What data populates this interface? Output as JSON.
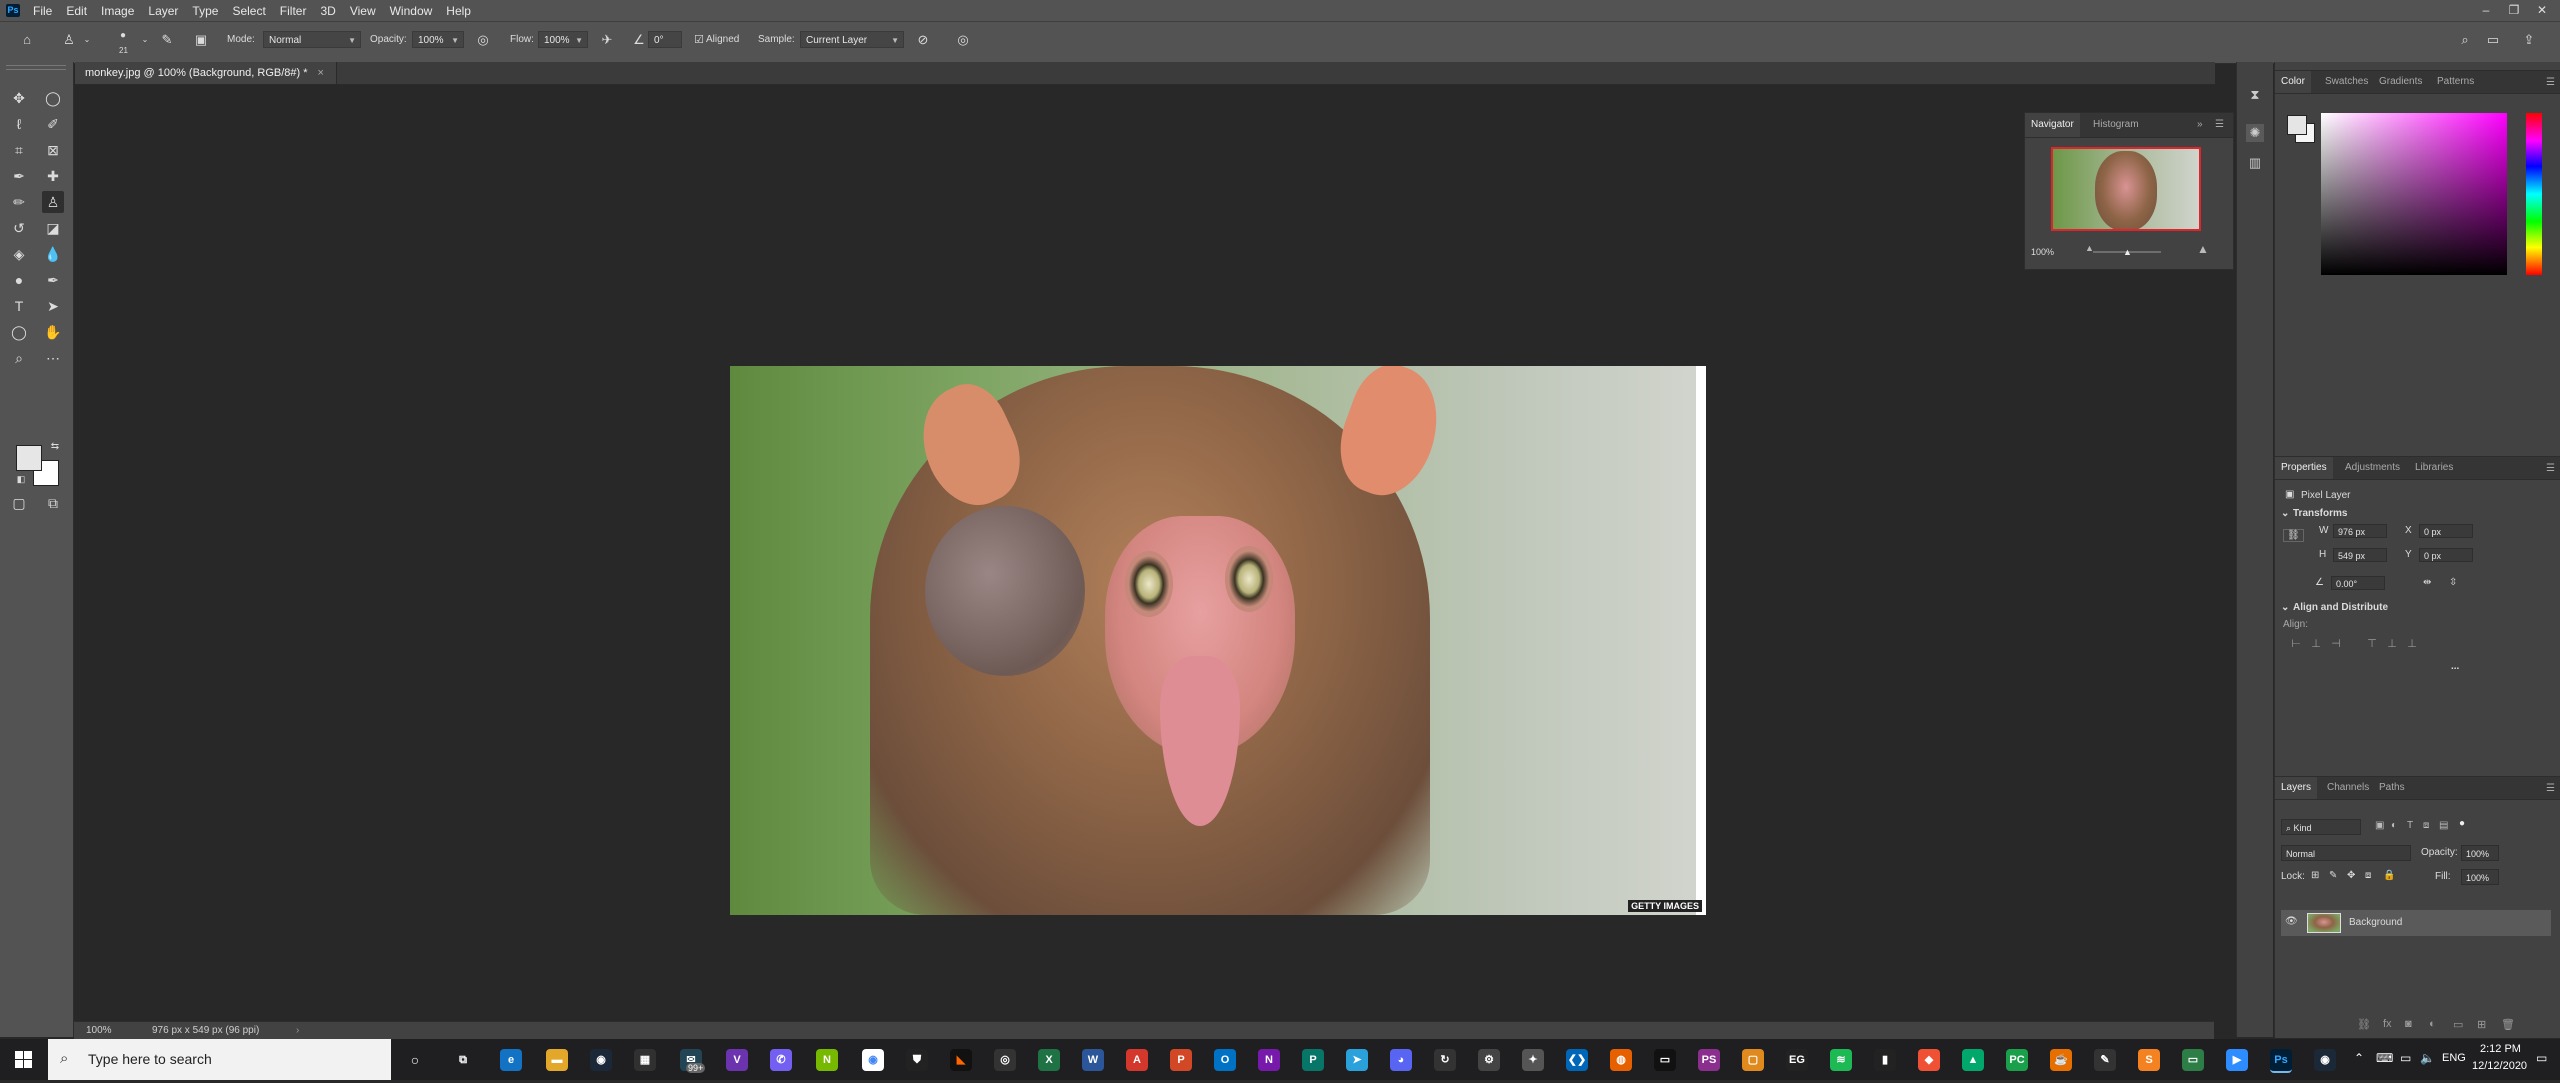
{
  "menubar": {
    "app_logo": "Ps",
    "items": [
      "File",
      "Edit",
      "Image",
      "Layer",
      "Type",
      "Select",
      "Filter",
      "3D",
      "View",
      "Window",
      "Help"
    ]
  },
  "options": {
    "brush_size": "21",
    "mode_label": "Mode:",
    "mode_value": "Normal",
    "opacity_label": "Opacity:",
    "opacity_value": "100%",
    "flow_label": "Flow:",
    "flow_value": "100%",
    "angle_value": "0°",
    "aligned_label": "Aligned",
    "sample_label": "Sample:",
    "sample_value": "Current Layer"
  },
  "document": {
    "tab_title": "monkey.jpg @ 100% (Background, RGB/8#) *",
    "watermark": "GETTY IMAGES"
  },
  "status": {
    "zoom": "100%",
    "doc_info": "976 px x 549 px (96 ppi)"
  },
  "navigator": {
    "tabs": [
      "Navigator",
      "Histogram"
    ],
    "zoom": "100%"
  },
  "color_panel": {
    "tabs": [
      "Color",
      "Swatches",
      "Gradients",
      "Patterns"
    ]
  },
  "properties": {
    "tabs": [
      "Properties",
      "Adjustments",
      "Libraries"
    ],
    "layer_type": "Pixel Layer",
    "transform_title": "Transforms",
    "w_label": "W",
    "w_value": "976 px",
    "h_label": "H",
    "h_value": "549 px",
    "x_label": "X",
    "x_value": "0 px",
    "y_label": "Y",
    "y_value": "0 px",
    "angle_value": "0.00°",
    "align_title": "Align and Distribute",
    "align_label": "Align:",
    "more": "..."
  },
  "layers": {
    "tabs": [
      "Layers",
      "Channels",
      "Paths"
    ],
    "filter_kind": "Kind",
    "blend_mode": "Normal",
    "opacity_label": "Opacity:",
    "opacity_value": "100%",
    "lock_label": "Lock:",
    "fill_label": "Fill:",
    "fill_value": "100%",
    "layer_name": "Background"
  },
  "taskbar": {
    "search_placeholder": "Type here to search",
    "badge": "99+",
    "lang": "ENG",
    "time": "2:12 PM",
    "date": "12/12/2020"
  }
}
